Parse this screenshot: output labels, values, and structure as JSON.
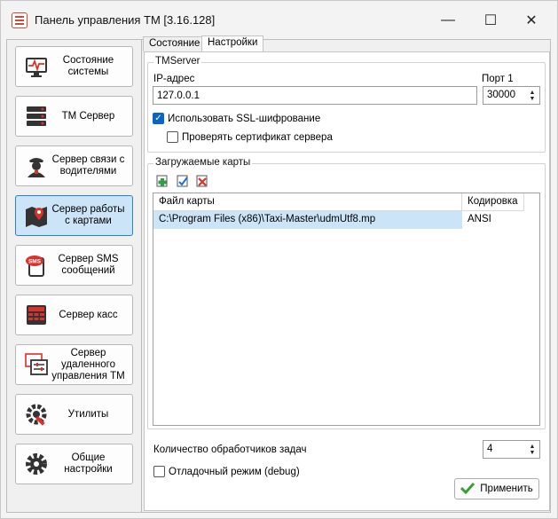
{
  "window": {
    "title": "Панель управления ТМ [3.16.128]",
    "controls": {
      "minimize": "—",
      "maximize": "☐",
      "close": "✕"
    }
  },
  "sidebar": {
    "items": [
      {
        "label": "Состояние системы",
        "icon": "monitor-heartbeat-icon",
        "active": false
      },
      {
        "label": "ТМ Сервер",
        "icon": "server-rack-icon",
        "active": false
      },
      {
        "label": "Сервер связи с водителями",
        "icon": "driver-icon",
        "active": false
      },
      {
        "label": "Сервер работы с картами",
        "icon": "map-pin-icon",
        "active": true
      },
      {
        "label": "Сервер SMS сообщений",
        "icon": "sms-icon",
        "active": false
      },
      {
        "label": "Сервер касс",
        "icon": "cash-register-icon",
        "active": false
      },
      {
        "label": "Сервер удаленного управления ТМ",
        "icon": "remote-control-icon",
        "active": false
      },
      {
        "label": "Утилиты",
        "icon": "wrench-gear-icon",
        "active": false
      },
      {
        "label": "Общие настройки",
        "icon": "gear-icon",
        "active": false
      }
    ]
  },
  "tabs": [
    {
      "label": "Состояние",
      "active": false
    },
    {
      "label": "Настройки",
      "active": true
    }
  ],
  "tmserver": {
    "legend": "TMServer",
    "ip_label": "IP-адрес",
    "ip_value": "127.0.0.1",
    "port_label": "Порт 1",
    "port_value": "30000",
    "ssl_label": "Использовать SSL-шифрование",
    "ssl_checked": true,
    "cert_label": "Проверять сертификат сервера",
    "cert_checked": false
  },
  "maps": {
    "legend": "Загружаемые карты",
    "toolbar": [
      "add-map-icon",
      "edit-map-icon",
      "delete-map-icon"
    ],
    "columns": [
      "Файл карты",
      "Кодировка"
    ],
    "rows": [
      {
        "file": "C:\\Program Files (x86)\\Taxi-Master\\udmUtf8.mp",
        "encoding": "ANSI"
      }
    ]
  },
  "workers": {
    "label": "Количество обработчиков задач",
    "value": "4"
  },
  "debug": {
    "label": "Отладочный режим (debug)",
    "checked": false
  },
  "apply_label": "Применить",
  "colors": {
    "accent": "#0a64c8",
    "selection": "#cce4f7",
    "active_border": "#2a7fd0",
    "icon_red": "#d9322b"
  }
}
